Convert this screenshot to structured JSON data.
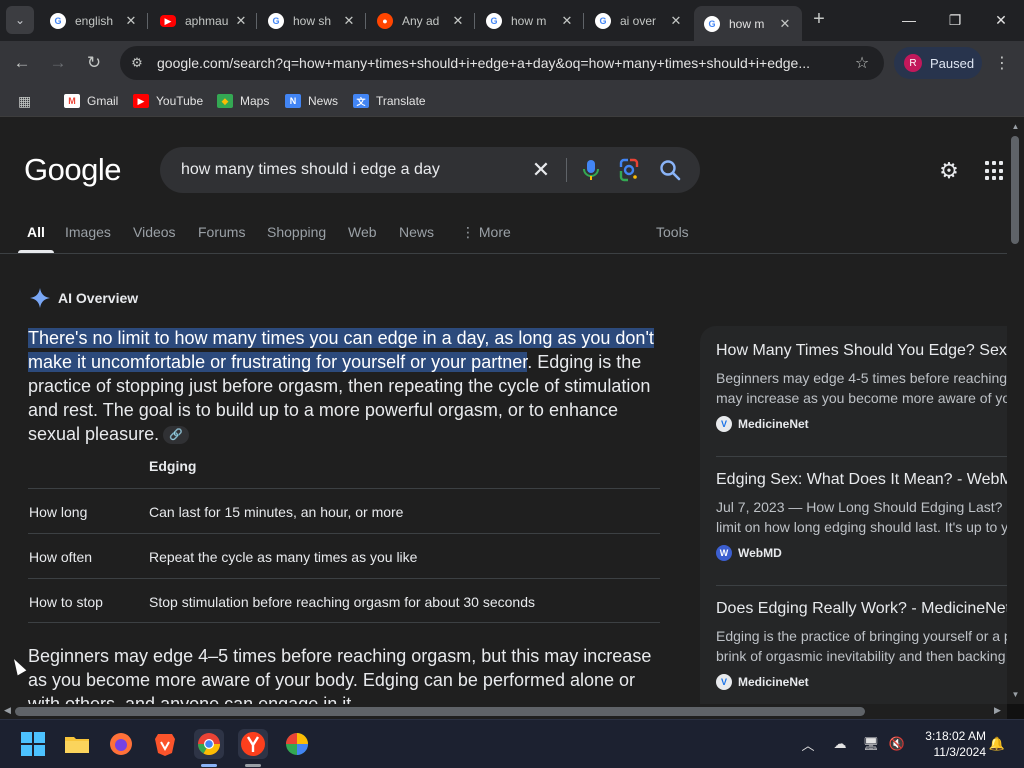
{
  "browser": {
    "tabs": [
      {
        "label": "english",
        "icon": "google-icon"
      },
      {
        "label": "aphmau",
        "icon": "youtube-icon"
      },
      {
        "label": "how sh",
        "icon": "google-icon"
      },
      {
        "label": "Any ad",
        "icon": "reddit-icon"
      },
      {
        "label": "how m",
        "icon": "google-icon"
      },
      {
        "label": "ai over",
        "icon": "google-icon"
      },
      {
        "label": "how m",
        "icon": "google-icon",
        "active": true
      }
    ],
    "url": "google.com/search?q=how+many+times+should+i+edge+a+day&oq=how+many+times+should+i+edge...",
    "profile_initial": "R",
    "profile_status": "Paused",
    "bookmarks": [
      "Gmail",
      "YouTube",
      "Maps",
      "News",
      "Translate"
    ]
  },
  "search": {
    "logo": "Google",
    "query": "how many times should i edge a day",
    "tabs": [
      "All",
      "Images",
      "Videos",
      "Forums",
      "Shopping",
      "Web",
      "News",
      "More"
    ],
    "tools_label": "Tools"
  },
  "ai_overview": {
    "label": "AI Overview",
    "p1_highlight": "There's no limit to how many times you can edge in a day, as long as you don't make it uncomfortable or frustrating for yourself or your partner",
    "p1_rest": ". Edging is the practice of stopping just before orgasm, then repeating the cycle of stimulation and rest. The goal is to build up to a more powerful orgasm, or to enhance sexual pleasure.",
    "table_header": "Edging",
    "rows": [
      {
        "k": "How long",
        "v": "Can last for 15 minutes, an hour, or more"
      },
      {
        "k": "How often",
        "v": "Repeat the cycle as many times as you like"
      },
      {
        "k": "How to stop",
        "v": "Stop stimulation before reaching orgasm for about 30 seconds"
      }
    ],
    "p2": "Beginners may edge 4–5 times before reaching orgasm, but this may increase as you become more aware of your body. Edging can be performed alone or with others, and anyone can engage in it."
  },
  "sources": [
    {
      "title": "How Many Times Should You Edge? Sex",
      "line1": "Beginners may edge 4-5 times before reaching",
      "line2": "may increase as you become more aware of yo",
      "site": "MedicineNet"
    },
    {
      "title": "Edging Sex: What Does It Mean? - WebM",
      "line1": "Jul 7, 2023 — How Long Should Edging Last?",
      "line2": "limit on how long edging should last. It's up to y",
      "site": "WebMD"
    },
    {
      "title": "Does Edging Really Work? - MedicineNet",
      "line1": "Edging is the practice of bringing yourself or a p",
      "line2": "brink of orgasmic inevitability and then backing",
      "site": "MedicineNet"
    }
  ],
  "taskbar": {
    "time": "3:18:02 AM",
    "date": "11/3/2024"
  },
  "colors": {
    "highlight": "#2c4a7c",
    "page_bg": "#1f1f1f",
    "accent_blue": "#8ab4f8"
  }
}
